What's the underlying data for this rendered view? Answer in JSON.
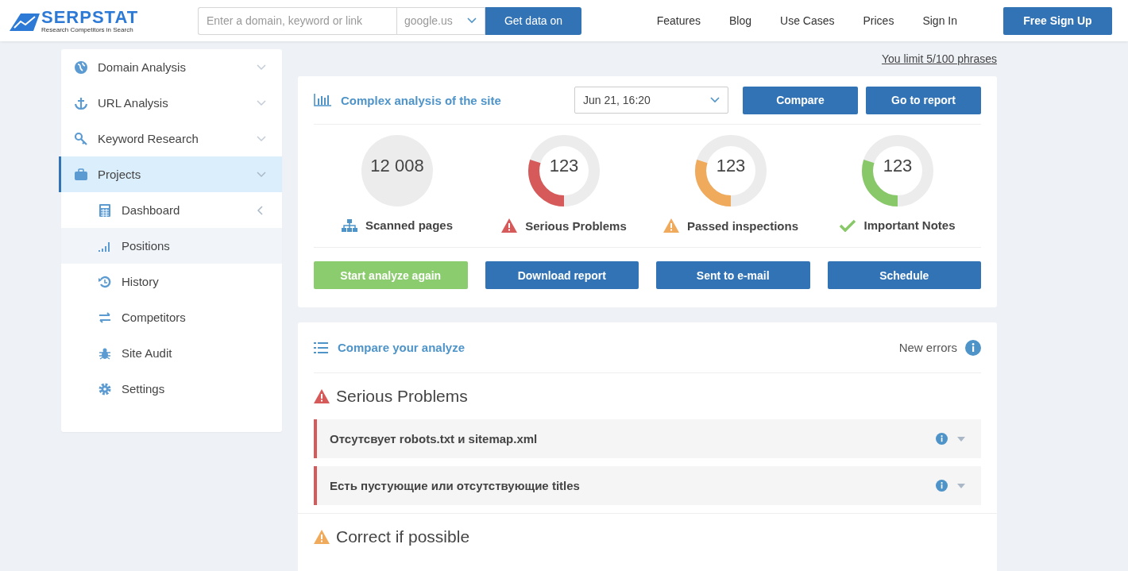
{
  "header": {
    "logo": {
      "name": "SERPSTAT",
      "tagline": "Research Competitors in Search"
    },
    "search": {
      "placeholder": "Enter a domain, keyword or link"
    },
    "engine": "google.us",
    "submit": "Get data on",
    "nav": [
      "Features",
      "Blog",
      "Use Cases",
      "Prices",
      "Sign In"
    ],
    "signup": "Free Sign Up"
  },
  "sidebar": {
    "items": [
      {
        "label": "Domain Analysis",
        "selected": false,
        "expanded": false
      },
      {
        "label": "URL Analysis",
        "selected": false,
        "expanded": false
      },
      {
        "label": "Keyword Research",
        "selected": false,
        "expanded": false
      },
      {
        "label": "Projects",
        "selected": true,
        "expanded": true,
        "children": [
          {
            "label": "Dashboard",
            "selected": false,
            "caret": true
          },
          {
            "label": "Positions",
            "selected": true,
            "caret": false
          },
          {
            "label": "History",
            "selected": false,
            "caret": false
          },
          {
            "label": "Competitors",
            "selected": false,
            "caret": false
          },
          {
            "label": "Site Audit",
            "selected": false,
            "caret": false
          },
          {
            "label": "Settings",
            "selected": false,
            "caret": false
          }
        ]
      }
    ]
  },
  "limit": "You limit 5/100 phrases",
  "analysis": {
    "title": "Complex analysis of the site",
    "date": "Jun 21, 16:20",
    "buttons": [
      "Compare",
      "Go to report"
    ],
    "stats": [
      {
        "kind": "total",
        "value": "12 008",
        "label": "Scanned pages"
      },
      {
        "kind": "donut",
        "value": "123",
        "label": "Serious Problems",
        "level": 0.3,
        "color": "#d65a5a"
      },
      {
        "kind": "donut",
        "value": "123",
        "label": "Passed inspections",
        "level": 0.3,
        "color": "#f0aa5c"
      },
      {
        "kind": "donut",
        "value": "123",
        "label": "Important Notes",
        "level": 0.3,
        "color": "#88c868"
      }
    ],
    "actions": [
      {
        "label": "Start analyze again",
        "kind": "primary"
      },
      {
        "label": "Download report",
        "kind": "default"
      },
      {
        "label": "Sent to e-mail",
        "kind": "default"
      },
      {
        "label": "Schedule",
        "kind": "default"
      }
    ]
  },
  "compare": {
    "title": "Compare your analyze",
    "filter": "New errors",
    "sections": [
      {
        "title": "Serious Problems",
        "color": "#d65a5a",
        "issues": [
          "Отсутсвует robots.txt и sitemap.xml",
          "Есть пустующие или отсутствующие titles"
        ]
      },
      {
        "title": "Correct if possible",
        "color": "#f0aa5c"
      }
    ]
  }
}
